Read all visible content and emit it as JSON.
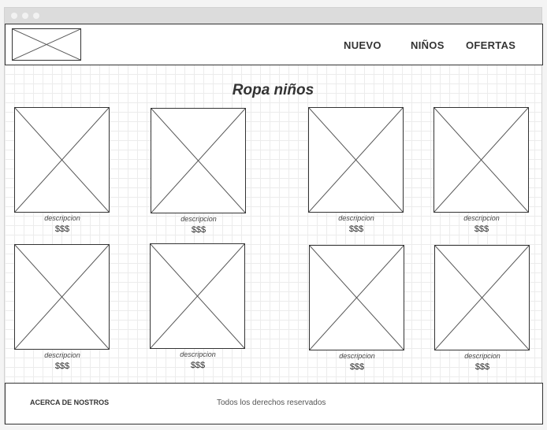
{
  "header": {
    "nav": [
      {
        "label": "NUEVO"
      },
      {
        "label": "NIÑOS"
      },
      {
        "label": "OFERTAS"
      }
    ]
  },
  "main": {
    "title": "Ropa niños",
    "products": [
      {
        "description": "descripcion",
        "price": "$$$"
      },
      {
        "description": "descripcion",
        "price": "$$$"
      },
      {
        "description": "descripcion",
        "price": "$$$"
      },
      {
        "description": "descripcion",
        "price": "$$$"
      },
      {
        "description": "descripcion",
        "price": "$$$"
      },
      {
        "description": "descripcion",
        "price": "$$$"
      },
      {
        "description": "descripcion",
        "price": "$$$"
      },
      {
        "description": "descripcion",
        "price": "$$$"
      }
    ]
  },
  "footer": {
    "about_label": "ACERCA DE NOSTROS",
    "rights_text": "Todos los derechos reservados"
  }
}
